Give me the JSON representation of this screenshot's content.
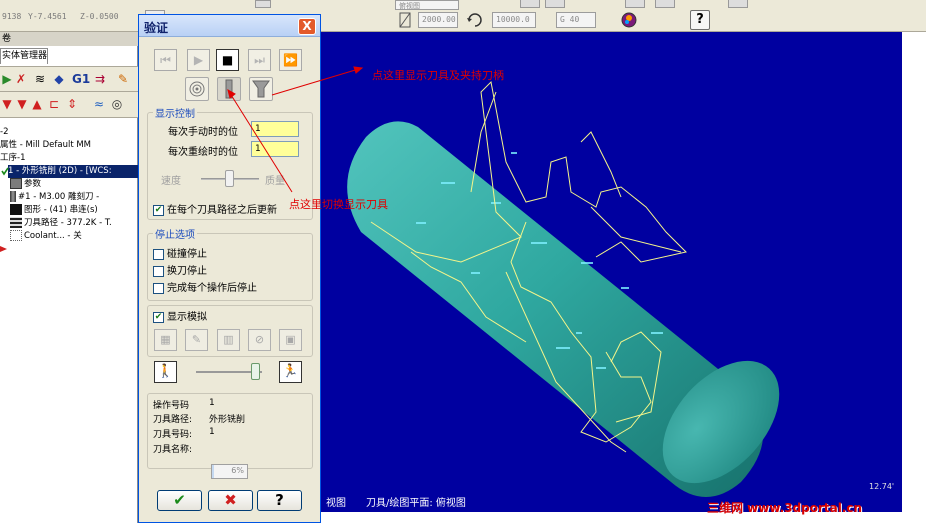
{
  "toolbar": {
    "coords": [
      "9138",
      "Y-7.4561",
      "Z-0.0500"
    ],
    "plane_label": "俯视图",
    "spindle": "2000.00",
    "feed": "10000.0",
    "gcode": "G 40",
    "help": "?"
  },
  "manager": {
    "caption": "卷",
    "tab": "实体管理器",
    "tree": [
      "-2",
      "属性 - Mill Default MM",
      "工序-1",
      "1 - 外形铣削 (2D) - [WCS:",
      "参数",
      "#1 - M3.00 雕刻刀 -",
      "图形 - (41) 串连(s)",
      "刀具路径 - 377.2K - T.",
      "Coolant... - 关"
    ],
    "g1_label": "G1"
  },
  "dialog": {
    "title": "验证",
    "close": "X",
    "display_control_title": "显示控制",
    "manual_step_label": "每次手动时的位",
    "manual_step_value": "1",
    "redraw_step_label": "每次重绘时的位",
    "redraw_step_value": "1",
    "speed_label": "速度",
    "quality_label": "质量",
    "update_after_path_label": "在每个刀具路径之后更新",
    "update_after_path_checked": true,
    "stop_options_title": "停止选项",
    "stop_options": [
      {
        "label": "碰撞停止",
        "checked": false
      },
      {
        "label": "换刀停止",
        "checked": false
      },
      {
        "label": "完成每个操作后停止",
        "checked": false
      }
    ],
    "show_simulation_label": "显示模拟",
    "show_simulation_checked": true,
    "info": {
      "op_no_label": "操作号码",
      "op_no_value": "1",
      "toolpath_label": "刀具路径:",
      "toolpath_value": "外形铣削",
      "tool_no_label": "刀具号码:",
      "tool_no_value": "1",
      "tool_name_label": "刀具名称:",
      "tool_name_value": ""
    },
    "progress_percent": 6,
    "progress_text": "6%",
    "ok_glyph": "✔",
    "cancel_glyph": "✖",
    "help_glyph": "?"
  },
  "viewport": {
    "background": "#0000a0",
    "cylinder_color": "#29a39c",
    "toolpath_color": "#f5f58a",
    "status_view": "视图",
    "status_plane": "刀具/绘图平面: 俯视图",
    "scale_text": "12.74'",
    "watermark": "三维网 www.3dportal.cn"
  },
  "annotations": {
    "show_tool_holder": "点这里显示刀具及夹持刀柄",
    "switch_tool_display": "点这里切换显示刀具"
  },
  "colors": {
    "annotation_red": "#e00000",
    "window_bg": "#ece9d8",
    "accent_blue": "#0054e3"
  }
}
